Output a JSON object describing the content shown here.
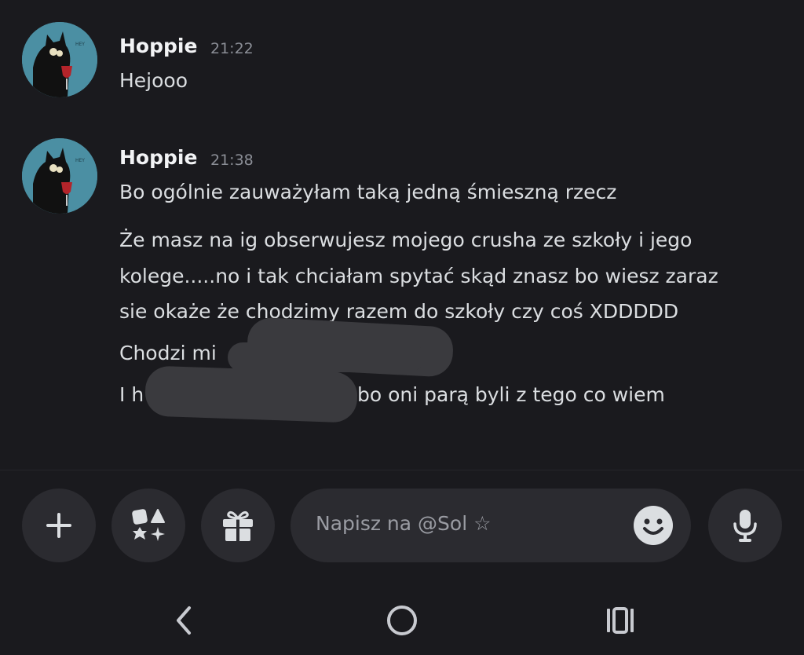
{
  "messages": [
    {
      "author": "Hoppie",
      "time": "21:22",
      "lines": [
        "Hejooo"
      ]
    },
    {
      "author": "Hoppie",
      "time": "21:38",
      "lines": [
        "Bo ogólnie zauważyłam taką jedną śmieszną rzecz",
        "Że masz na ig obserwujesz mojego crusha ze szkoły i jego",
        "kolege.....no i tak chciałam spytać skąd znasz bo wiesz zaraz",
        "sie okaże że chodzimy razem do szkoły czy coś XDDDDD",
        "Chodzi mi",
        "I h",
        "bo oni parą byli z tego co wiem"
      ]
    }
  ],
  "composer": {
    "placeholder": "Napisz na @Sol ☆"
  },
  "icons": {
    "add": "plus-icon",
    "apps": "apps-icon",
    "gift": "gift-icon",
    "emoji": "emoji-icon",
    "mic": "microphone-icon",
    "back": "back-nav-icon",
    "home": "home-nav-icon",
    "recents": "recents-nav-icon"
  },
  "colors": {
    "background": "#1a1a1e",
    "surface": "#2b2b30",
    "text": "#dbdee1",
    "muted": "#8b8e96"
  }
}
